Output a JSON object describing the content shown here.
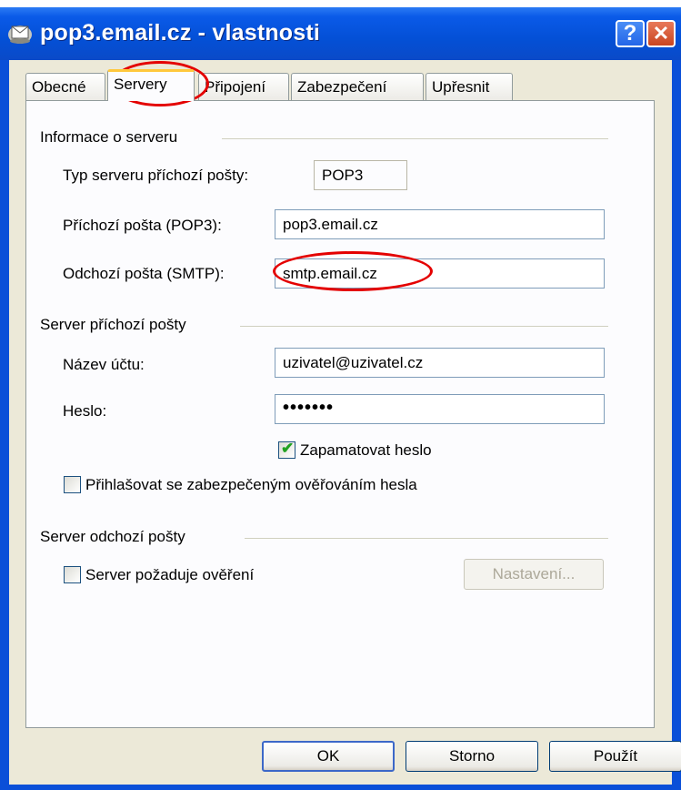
{
  "dialog": {
    "title": "pop3.email.cz - vlastnosti",
    "help_glyph": "?",
    "close_glyph": "✕",
    "icon": "mail-account-icon"
  },
  "tabs": [
    {
      "label": "Obecné",
      "active": false
    },
    {
      "label": "Servery",
      "active": true
    },
    {
      "label": "Připojení",
      "active": false
    },
    {
      "label": "Zabezpečení",
      "active": false
    },
    {
      "label": "Upřesnit",
      "active": false
    }
  ],
  "server_info": {
    "group_label": "Informace o serveru",
    "type_label": "Typ serveru příchozí pošty:",
    "type_value": "POP3",
    "incoming_label": "Příchozí pošta (POP3):",
    "incoming_value": "pop3.email.cz",
    "outgoing_label": "Odchozí pošta (SMTP):",
    "outgoing_value": "smtp.email.cz"
  },
  "incoming_server": {
    "group_label": "Server příchozí pošty",
    "account_label": "Název účtu:",
    "account_value": "uzivatel@uzivatel.cz",
    "password_label": "Heslo:",
    "password_value": "•••••••",
    "remember_label": "Zapamatovat heslo",
    "remember_checked": true,
    "spa_label": "Přihlašovat se zabezpečeným ověřováním hesla",
    "spa_checked": false
  },
  "outgoing_server": {
    "group_label": "Server odchozí pošty",
    "auth_label": "Server požaduje ověření",
    "auth_checked": false,
    "settings_button": "Nastavení..."
  },
  "buttons": {
    "ok": "OK",
    "cancel": "Storno",
    "apply": "Použít"
  },
  "colors": {
    "titlebar": "#0a4fd8",
    "annotation": "#e40000",
    "check": "#21a121"
  }
}
